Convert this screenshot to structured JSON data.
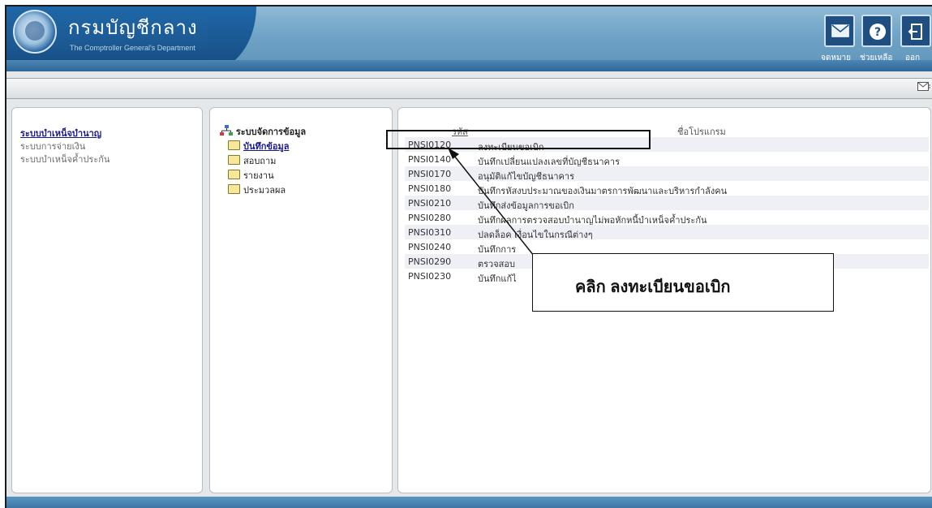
{
  "header": {
    "org_name_th": "กรมบัญชีกลาง",
    "org_name_en": "The Comptroller General's Department",
    "buttons": [
      {
        "label": "จดหมาย",
        "icon": "mail-icon"
      },
      {
        "label": "ช่วยเหลือ",
        "icon": "help-icon"
      },
      {
        "label": "ออก",
        "icon": "logout-icon"
      }
    ]
  },
  "toolbar": {
    "icon": "mail-small-icon"
  },
  "left_menu": {
    "items": [
      {
        "label": "ระบบบำเหน็จบำนาญ",
        "active": true
      },
      {
        "label": "ระบบการจ่ายเงิน",
        "active": false
      },
      {
        "label": "ระบบบำเหน็จค้ำประกัน",
        "active": false
      }
    ]
  },
  "tree": {
    "root": "ระบบจัดการข้อมูล",
    "items": [
      {
        "label": "บันทึกข้อมูล",
        "selected": true
      },
      {
        "label": "สอบถาม",
        "selected": false
      },
      {
        "label": "รายงาน",
        "selected": false
      },
      {
        "label": "ประมวลผล",
        "selected": false
      }
    ]
  },
  "program_table": {
    "columns": [
      "รหัส",
      "ชื่อโปรแกรม"
    ],
    "rows": [
      {
        "code": "PNSI0120",
        "name": "ลงทะเบียนขอเบิก"
      },
      {
        "code": "PNSI0140",
        "name": "บันทึกเปลี่ยนแปลงเลขที่บัญชีธนาคาร"
      },
      {
        "code": "PNSI0170",
        "name": "อนุมัติแก้ไขบัญชีธนาคาร"
      },
      {
        "code": "PNSI0180",
        "name": "บันทึกรหัสงบประมาณของเงินมาตรการพัฒนาและบริหารกำลังคน"
      },
      {
        "code": "PNSI0210",
        "name": "บันทึกส่งข้อมูลการขอเบิก"
      },
      {
        "code": "PNSI0280",
        "name": "บันทึกผลการตรวจสอบบำนาญไม่พอหักหนี้บำเหน็จค้ำประกัน"
      },
      {
        "code": "PNSI0310",
        "name": "ปลดล็อค เงื่อนไขในกรณีต่างๆ"
      },
      {
        "code": "PNSI0240",
        "name": "บันทึกการ"
      },
      {
        "code": "PNSI0290",
        "name": "ตรวจสอบ"
      },
      {
        "code": "PNSI0230",
        "name": "บันทึกแก้ไ"
      }
    ]
  },
  "callout": {
    "text": "คลิก ลงทะเบียนขอเบิก"
  }
}
